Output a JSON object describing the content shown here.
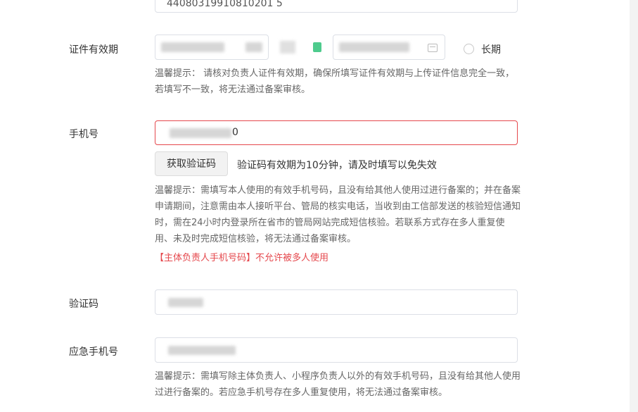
{
  "top_field": {
    "value": "44080319910810201 5"
  },
  "validity": {
    "label": "证件有效期",
    "long_term_label": "长期",
    "hint": "温馨提示： 请核对负责人证件有效期，确保所填写证件有效期与上传证件信息完全一致，若填写不一致，将无法通过备案审核。"
  },
  "phone": {
    "label": "手机号",
    "value_suffix": "0",
    "get_code_button": "获取验证码",
    "code_validity_note": "验证码有效期为10分钟，请及时填写以免失效",
    "hint": "温馨提示：需填写本人使用的有效手机号码，且没有给其他人使用过进行备案的；并在备案申请期间，注意需由本人接听平台、管局的核实电话，当收到由工信部发送的核验短信通知时，需在24小时内登录所在省市的管局网站完成短信核验。若联系方式存在多人重复使用、未及时完成短信核验，将无法通过备案审核。",
    "warning": "【主体负责人手机号码】不允许被多人使用"
  },
  "verification_code": {
    "label": "验证码"
  },
  "emergency_phone": {
    "label": "应急手机号",
    "hint": "温馨提示：需填写除主体负责人、小程序负责人以外的有效手机号码，且没有给其他人使用过进行备案的。若应急手机号存在多人重复使用，将无法通过备案审核。"
  },
  "colors": {
    "error": "#e5484d",
    "border": "#dcdfe6",
    "hint_text": "#666666"
  },
  "icons": {
    "calendar": "calendar-icon",
    "radio": "radio-button"
  }
}
